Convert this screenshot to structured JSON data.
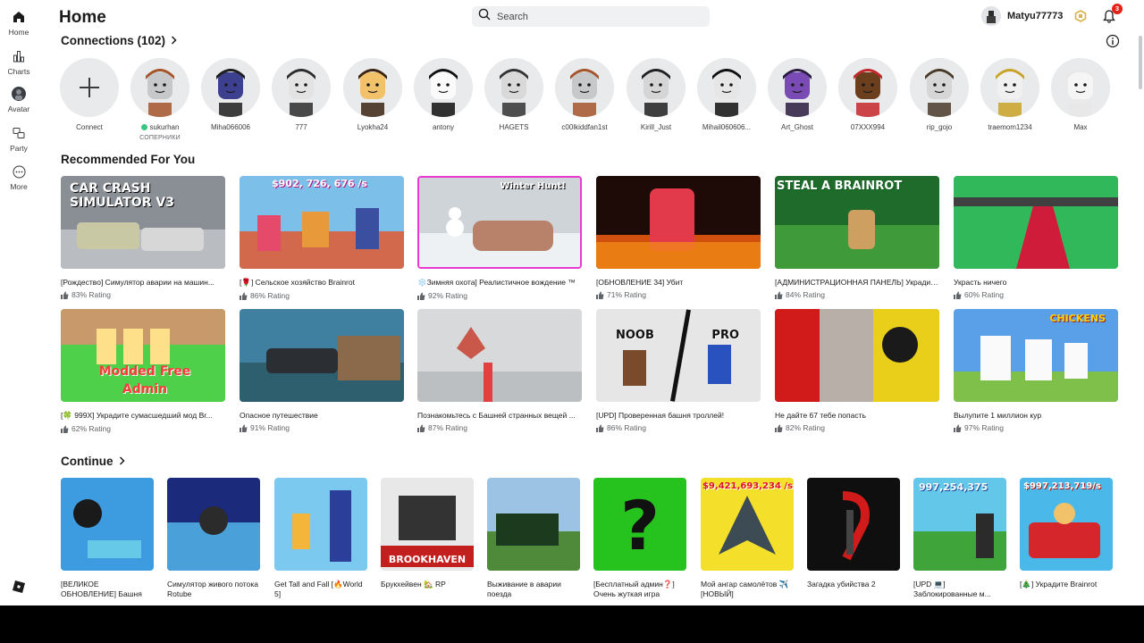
{
  "sidebar": {
    "items": [
      {
        "label": "Home",
        "icon": "home-icon"
      },
      {
        "label": "Charts",
        "icon": "charts-icon"
      },
      {
        "label": "Avatar",
        "icon": "avatar-icon"
      },
      {
        "label": "Party",
        "icon": "party-icon"
      },
      {
        "label": "More",
        "icon": "more-icon"
      }
    ]
  },
  "header": {
    "title": "Home",
    "search_placeholder": "Search",
    "username": "Matyu77773",
    "notification_count": "3"
  },
  "connections": {
    "title": "Connections (102)",
    "connect_label": "Connect",
    "items": [
      {
        "name": "sukurhan",
        "sub": "СОПЕРНИКИ",
        "online": true
      },
      {
        "name": "Miha066006"
      },
      {
        "name": "777"
      },
      {
        "name": "Lyokha24"
      },
      {
        "name": "antony"
      },
      {
        "name": "HAGETS"
      },
      {
        "name": "c00lkiddfan1st"
      },
      {
        "name": "Kirill_Just"
      },
      {
        "name": "Mihail060606..."
      },
      {
        "name": "Art_Ghost"
      },
      {
        "name": "07XXX994"
      },
      {
        "name": "rip_gojo"
      },
      {
        "name": "traemom1234"
      },
      {
        "name": "Max"
      }
    ]
  },
  "recommended": {
    "title": "Recommended For You",
    "row1": [
      {
        "title": "[Рождество] Симулятор аварии на машин...",
        "rating": "83% Rating",
        "thumb_text": "CAR CRASH SIMULATOR V3"
      },
      {
        "title": "[🌹] Сельское хозяйство Brainrot",
        "rating": "86% Rating",
        "thumb_text": "$902, 726, 676 /s"
      },
      {
        "title": "❄️Зимняя охота] Реалистичное вождение ™",
        "rating": "92% Rating",
        "thumb_text": "Winter Hunt!"
      },
      {
        "title": "[ОБНОВЛЕНИЕ 34] Убит",
        "rating": "71% Rating",
        "thumb_text": ""
      },
      {
        "title": "[АДМИНИСТРАЦИОННАЯ ПАНЕЛЬ] Украдит...",
        "rating": "84% Rating",
        "thumb_text": "STEAL A BRAINROT"
      },
      {
        "title": "Украсть ничего",
        "rating": "60% Rating",
        "thumb_text": ""
      }
    ],
    "row2": [
      {
        "title": "[🍀 999X] Украдите сумасшедший мод Br...",
        "rating": "62% Rating",
        "thumb_text": "Modded Free Admin"
      },
      {
        "title": "Опасное путешествие",
        "rating": "91% Rating",
        "thumb_text": ""
      },
      {
        "title": "Познакомьтесь с Башней странных вещей ...",
        "rating": "87% Rating",
        "thumb_text": ""
      },
      {
        "title": "[UPD] Проверенная башня троллей!",
        "rating": "86% Rating",
        "thumb_text": "NOOB PRO"
      },
      {
        "title": "Не дайте 67 тебе попасть",
        "rating": "82% Rating",
        "thumb_text": ""
      },
      {
        "title": "Вылупите 1 миллион кур",
        "rating": "97% Rating",
        "thumb_text": "CHICKENS"
      }
    ]
  },
  "continue": {
    "title": "Continue",
    "items": [
      {
        "title": "[ВЕЛИКОЕ ОБНОВЛЕНИЕ] Башня"
      },
      {
        "title": "Симулятор живого потока Rotube"
      },
      {
        "title": "Get Tall and Fall [🔥World 5]"
      },
      {
        "title": "Брукхейвен 🏡 RP",
        "thumb_text": "BROOKHAVEN"
      },
      {
        "title": "Выживание в аварии поезда"
      },
      {
        "title": "[Бесплатный админ❓] Очень жуткая игра"
      },
      {
        "title": "Мой ангар самолётов ✈️ [НОВЫЙ]",
        "thumb_text": "$9,421,693,234 /s"
      },
      {
        "title": "Загадка убийства 2"
      },
      {
        "title": "[UPD 💻] Заблокированные м...",
        "thumb_text": "997,254,375"
      },
      {
        "title": "[🎄] Украдите Brainrot",
        "thumb_text": "$997,213,719/s"
      }
    ]
  },
  "colors": {
    "accent": "#335fff",
    "online": "#39c582",
    "badge": "#e2231a"
  }
}
